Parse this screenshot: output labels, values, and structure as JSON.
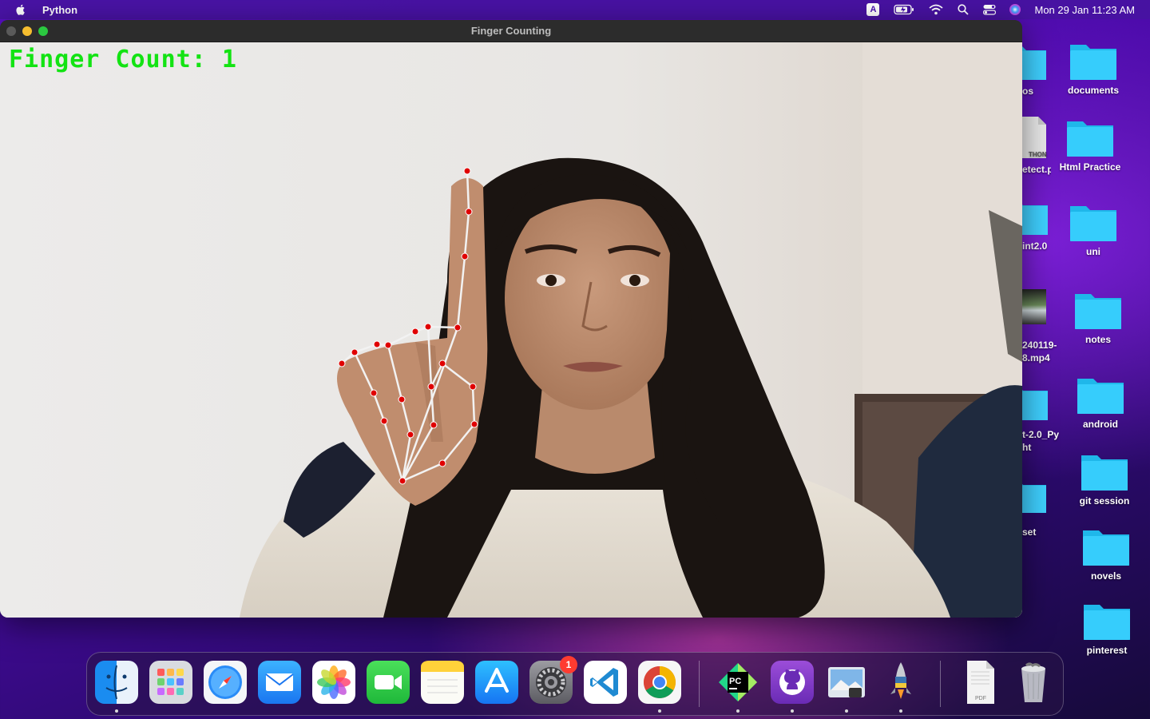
{
  "menubar": {
    "app_name": "Python",
    "input_source": "A",
    "clock": "Mon 29 Jan  11:23 AM"
  },
  "window": {
    "title": "Finger Counting",
    "overlay_text": "Finger Count: 1"
  },
  "desktop": {
    "icons": [
      {
        "label": "documents",
        "icon": "folder-icon"
      },
      {
        "label": "Html Practice",
        "icon": "folder-icon"
      },
      {
        "label": "uni",
        "icon": "folder-icon"
      },
      {
        "label": "notes",
        "icon": "folder-icon"
      },
      {
        "label": "android",
        "icon": "folder-icon"
      },
      {
        "label": "git session",
        "icon": "folder-icon"
      },
      {
        "label": "novels",
        "icon": "folder-icon"
      },
      {
        "label": "pinterest",
        "icon": "folder-icon"
      }
    ],
    "partial_icons": [
      {
        "label": "os"
      },
      {
        "label": "etect.py",
        "badge": "THON"
      },
      {
        "label": "int2.0"
      },
      {
        "label": "240119-\n8.mp4"
      },
      {
        "label": "t-2.0_Py\nht"
      },
      {
        "label": "set"
      }
    ]
  },
  "dock": {
    "items": [
      {
        "name": "Finder",
        "icon": "finder-icon",
        "running": true
      },
      {
        "name": "Launchpad",
        "icon": "launchpad-icon",
        "running": false
      },
      {
        "name": "Safari",
        "icon": "safari-icon",
        "running": false
      },
      {
        "name": "Mail",
        "icon": "mail-icon",
        "running": false
      },
      {
        "name": "Photos",
        "icon": "photos-icon",
        "running": false
      },
      {
        "name": "FaceTime",
        "icon": "facetime-icon",
        "running": false
      },
      {
        "name": "Notes",
        "icon": "notes-icon",
        "running": false
      },
      {
        "name": "App Store",
        "icon": "app-store-icon",
        "running": false
      },
      {
        "name": "System Settings",
        "icon": "settings-icon",
        "running": false,
        "badge": "1"
      },
      {
        "name": "Visual Studio Code",
        "icon": "vscode-icon",
        "running": false
      },
      {
        "name": "Google Chrome",
        "icon": "chrome-icon",
        "running": true
      },
      {
        "name": "PyCharm",
        "icon": "pycharm-icon",
        "running": true,
        "text": "PC"
      },
      {
        "name": "GitHub Desktop",
        "icon": "github-icon",
        "running": true
      },
      {
        "name": "Preview",
        "icon": "preview-icon",
        "running": true
      },
      {
        "name": "Python Launcher",
        "icon": "python-rocket-icon",
        "running": true
      },
      {
        "name": "PDF document",
        "icon": "pdf-icon",
        "running": false,
        "text": "PDF"
      },
      {
        "name": "Trash",
        "icon": "trash-icon",
        "running": false
      }
    ]
  },
  "colors": {
    "overlay_text": "#13e313",
    "landmark": "#e00000",
    "connection": "#ffffff",
    "folder": "#29c3f5"
  }
}
